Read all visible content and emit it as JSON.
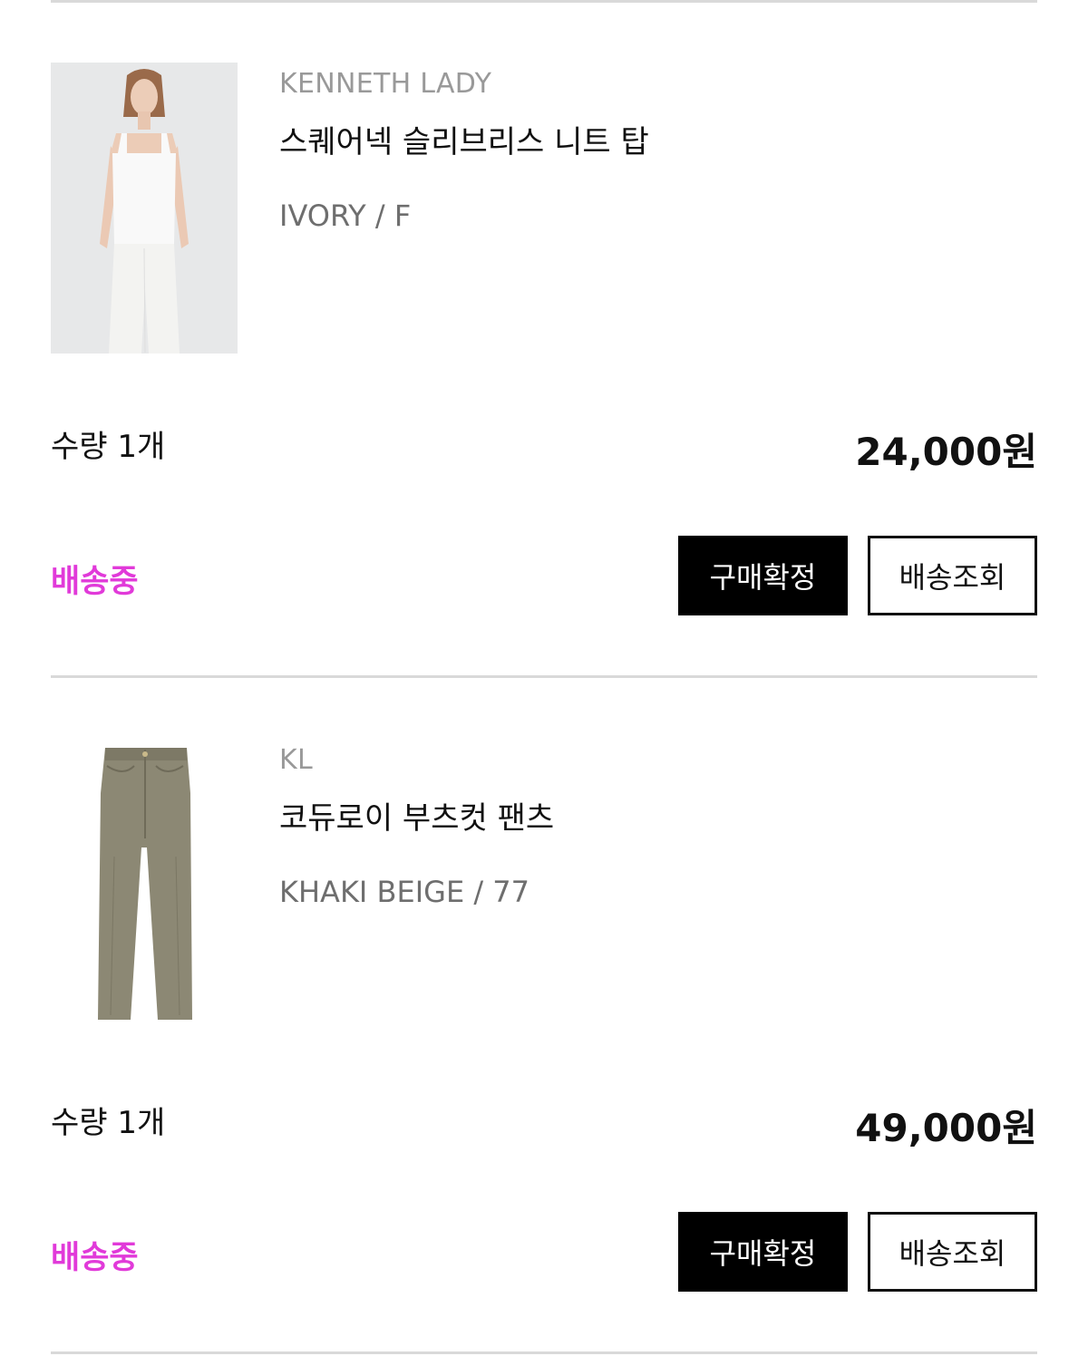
{
  "orders": [
    {
      "brand": "KENNETH LADY",
      "product_name": "스퀘어넥 슬리브리스 니트 탑",
      "option": "IVORY / F",
      "quantity": "수량 1개",
      "price": "24,000원",
      "status": "배송중",
      "status_color": "#e13ad9",
      "confirm_label": "구매확정",
      "track_label": "배송조회",
      "image_icon": "model-sleeveless-top-photo"
    },
    {
      "brand": "KL",
      "product_name": "코듀로이 부츠컷 팬츠",
      "option": "KHAKI BEIGE / 77",
      "quantity": "수량 1개",
      "price": "49,000원",
      "status": "배송중",
      "status_color": "#e13ad9",
      "confirm_label": "구매확정",
      "track_label": "배송조회",
      "image_icon": "corduroy-pants-photo"
    }
  ]
}
